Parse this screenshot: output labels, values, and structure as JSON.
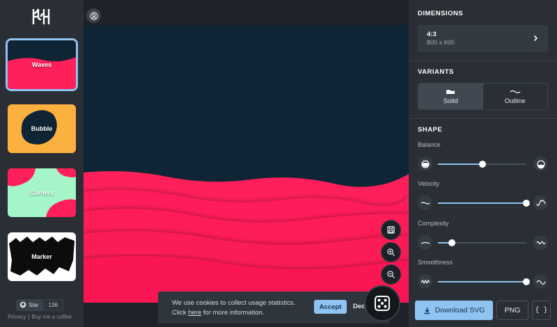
{
  "sidebar": {
    "items": [
      {
        "label": "Waves",
        "selected": true
      },
      {
        "label": "Bubble",
        "selected": false
      },
      {
        "label": "Corners",
        "selected": false
      },
      {
        "label": "Marker",
        "selected": false
      }
    ],
    "star_label": "Star",
    "star_count": "136",
    "privacy_link": "Privacy",
    "separator": "|",
    "coffee_link": "Buy me a coffee"
  },
  "canvas": {
    "colors": {
      "background": "#0f2536",
      "wave": "#ff1f5a"
    }
  },
  "cookie": {
    "line1": "We use cookies to collect usage statistics.",
    "click": "Click",
    "here": "here",
    "line2_rest": "for more information.",
    "accept": "Accept",
    "decline": "Decline"
  },
  "panel": {
    "dimensions": {
      "title": "DIMENSIONS",
      "ratio": "4:3",
      "size": "800 x 600"
    },
    "variants": {
      "title": "VARIANTS",
      "options": [
        {
          "label": "Solid",
          "active": true
        },
        {
          "label": "Outline",
          "active": false
        }
      ]
    },
    "shape": {
      "title": "SHAPE",
      "sliders": [
        {
          "label": "Balance",
          "value": 0.5
        },
        {
          "label": "Velocity",
          "value": 1.0
        },
        {
          "label": "Complexity",
          "value": 0.16
        },
        {
          "label": "Smoothness",
          "value": 1.0
        }
      ]
    },
    "actions": {
      "download": "Download SVG",
      "png": "PNG",
      "code": "{ }"
    }
  },
  "theme": {
    "accent": "#8fc3f1"
  }
}
